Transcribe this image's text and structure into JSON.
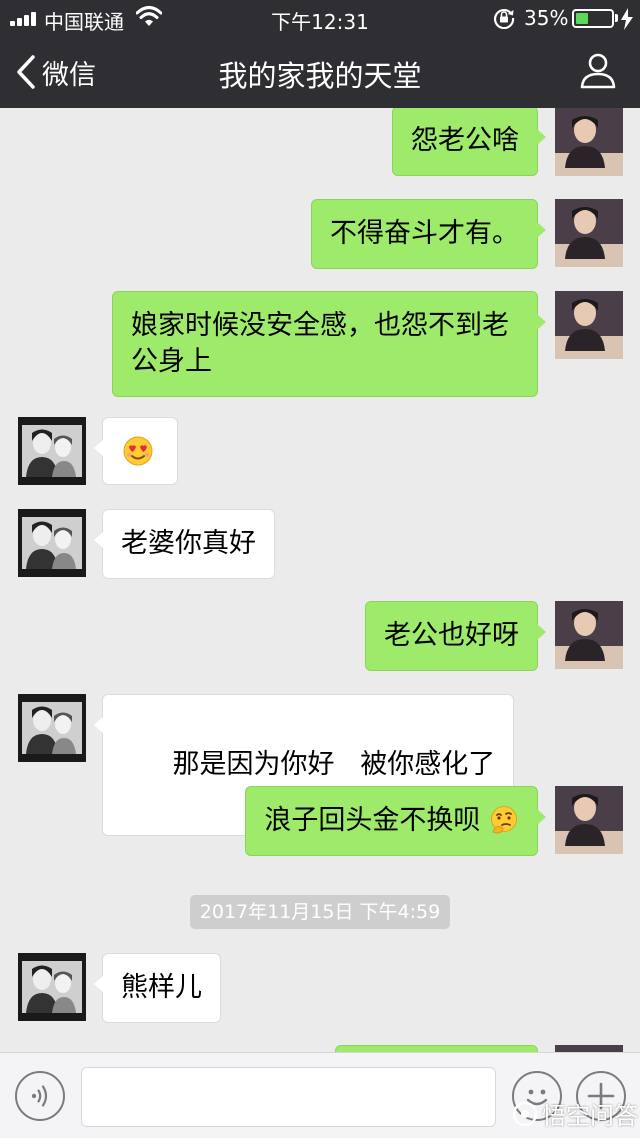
{
  "status_bar": {
    "carrier": "中国联通",
    "time": "下午12:31",
    "battery_percent": "35%",
    "battery_level": 0.35
  },
  "nav": {
    "back_label": "微信",
    "title": "我的家我的天堂"
  },
  "messages": [
    {
      "from": "me",
      "text": "怨老公啥"
    },
    {
      "from": "me",
      "text": "不得奋斗才有。"
    },
    {
      "from": "me",
      "text": "娘家时候没安全感，也怨不到老公身上"
    },
    {
      "from": "other",
      "emoji": "heart-eyes-emoji"
    },
    {
      "from": "other",
      "text": "老婆你真好"
    },
    {
      "from": "me",
      "text": "老公也好呀"
    },
    {
      "from": "other",
      "text": "那是因为你好   被你感化了"
    },
    {
      "from": "me",
      "text": "浪子回头金不换呗",
      "trailing_emoji": "thinking-emoji"
    },
    {
      "from": "other",
      "text": "熊样儿"
    }
  ],
  "timestamp": "2017年11月15日 下午4:59",
  "watermark": "悟空问答",
  "colors": {
    "header_bg": "#2e2e33",
    "chat_bg": "#ebebeb",
    "my_bubble": "#9eea6a",
    "their_bubble": "#ffffff"
  }
}
